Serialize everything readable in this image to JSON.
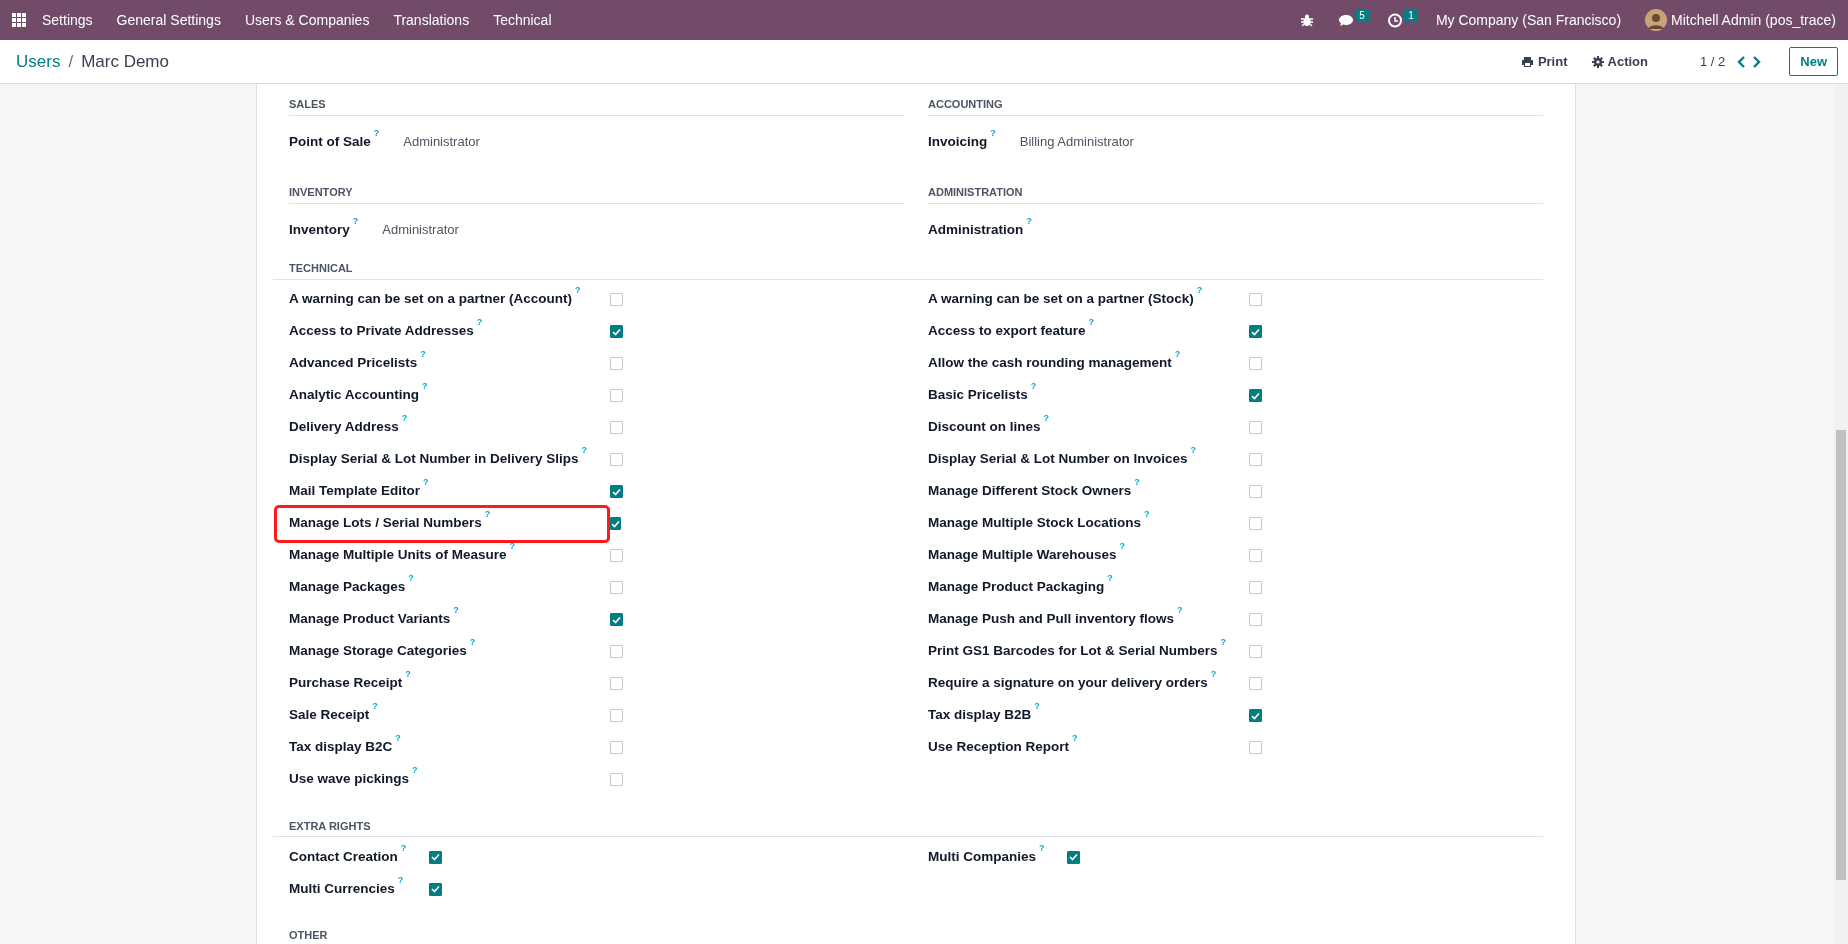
{
  "navbar": {
    "app": "Settings",
    "menu": [
      "General Settings",
      "Users & Companies",
      "Translations",
      "Technical"
    ],
    "messages_badge": "5",
    "activities_badge": "1",
    "company": "My Company (San Francisco)",
    "user": "Mitchell Admin (pos_trace)"
  },
  "breadcrumb": {
    "parent": "Users",
    "separator": "/",
    "current": "Marc Demo"
  },
  "actions": {
    "print": "Print",
    "action": "Action",
    "pager": "1 / 2",
    "new": "New"
  },
  "sections": [
    {
      "kind": "pair",
      "groups": [
        {
          "title": "SALES",
          "fields": [
            {
              "label": "Point of Sale",
              "help": "?",
              "value": "Administrator"
            }
          ]
        },
        {
          "title": "ACCOUNTING",
          "fields": [
            {
              "label": "Invoicing",
              "help": "?",
              "value": "Billing Administrator"
            }
          ]
        }
      ]
    },
    {
      "kind": "pair",
      "groups": [
        {
          "title": "INVENTORY",
          "fields": [
            {
              "label": "Inventory",
              "help": "?",
              "value": "Administrator"
            }
          ]
        },
        {
          "title": "ADMINISTRATION",
          "fields": [
            {
              "label": "Administration",
              "help": "?"
            }
          ]
        }
      ]
    },
    {
      "kind": "checks",
      "title": "TECHNICAL",
      "columns": [
        [
          {
            "label": "A warning can be set on a partner (Account)",
            "help": "?",
            "checked": false,
            "highlighted": false
          },
          {
            "label": "Access to Private Addresses",
            "help": "?",
            "checked": true,
            "highlighted": false
          },
          {
            "label": "Advanced Pricelists",
            "help": "?",
            "checked": false,
            "highlighted": false
          },
          {
            "label": "Analytic Accounting",
            "help": "?",
            "checked": false,
            "highlighted": false
          },
          {
            "label": "Delivery Address",
            "help": "?",
            "checked": false,
            "highlighted": false
          },
          {
            "label": "Display Serial & Lot Number in Delivery Slips",
            "help": "?",
            "checked": false,
            "highlighted": false
          },
          {
            "label": "Mail Template Editor",
            "help": "?",
            "checked": true,
            "highlighted": false
          },
          {
            "label": "Manage Lots / Serial Numbers",
            "help": "?",
            "checked": true,
            "highlighted": true
          },
          {
            "label": "Manage Multiple Units of Measure",
            "help": "?",
            "checked": false,
            "highlighted": false
          },
          {
            "label": "Manage Packages",
            "help": "?",
            "checked": false,
            "highlighted": false
          },
          {
            "label": "Manage Product Variants",
            "help": "?",
            "checked": true,
            "highlighted": false
          },
          {
            "label": "Manage Storage Categories",
            "help": "?",
            "checked": false,
            "highlighted": false
          },
          {
            "label": "Purchase Receipt",
            "help": "?",
            "checked": false,
            "highlighted": false
          },
          {
            "label": "Sale Receipt",
            "help": "?",
            "checked": false,
            "highlighted": false
          },
          {
            "label": "Tax display B2C",
            "help": "?",
            "checked": false,
            "highlighted": false
          },
          {
            "label": "Use wave pickings",
            "help": "?",
            "checked": false,
            "highlighted": false
          }
        ],
        [
          {
            "label": "A warning can be set on a partner (Stock)",
            "help": "?",
            "checked": false,
            "highlighted": false
          },
          {
            "label": "Access to export feature",
            "help": "?",
            "checked": true,
            "highlighted": false
          },
          {
            "label": "Allow the cash rounding management",
            "help": "?",
            "checked": false,
            "highlighted": false
          },
          {
            "label": "Basic Pricelists",
            "help": "?",
            "checked": true,
            "highlighted": false
          },
          {
            "label": "Discount on lines",
            "help": "?",
            "checked": false,
            "highlighted": false
          },
          {
            "label": "Display Serial & Lot Number on Invoices",
            "help": "?",
            "checked": false,
            "highlighted": false
          },
          {
            "label": "Manage Different Stock Owners",
            "help": "?",
            "checked": false,
            "highlighted": false
          },
          {
            "label": "Manage Multiple Stock Locations",
            "help": "?",
            "checked": false,
            "highlighted": false
          },
          {
            "label": "Manage Multiple Warehouses",
            "help": "?",
            "checked": false,
            "highlighted": false
          },
          {
            "label": "Manage Product Packaging",
            "help": "?",
            "checked": false,
            "highlighted": false
          },
          {
            "label": "Manage Push and Pull inventory flows",
            "help": "?",
            "checked": false,
            "highlighted": false
          },
          {
            "label": "Print GS1 Barcodes for Lot & Serial Numbers",
            "help": "?",
            "checked": false,
            "highlighted": false
          },
          {
            "label": "Require a signature on your delivery orders",
            "help": "?",
            "checked": false,
            "highlighted": false
          },
          {
            "label": "Tax display B2B",
            "help": "?",
            "checked": true,
            "highlighted": false
          },
          {
            "label": "Use Reception Report",
            "help": "?",
            "checked": false,
            "highlighted": false
          }
        ]
      ]
    },
    {
      "kind": "checks",
      "title": "EXTRA RIGHTS",
      "columns": [
        [
          {
            "label": "Contact Creation",
            "help": "?",
            "checked": true,
            "highlighted": false
          },
          {
            "label": "Multi Currencies",
            "help": "?",
            "checked": true,
            "highlighted": false
          }
        ],
        [
          {
            "label": "Multi Companies",
            "help": "?",
            "checked": true,
            "highlighted": false
          }
        ]
      ]
    },
    {
      "kind": "title",
      "title": "OTHER"
    }
  ]
}
